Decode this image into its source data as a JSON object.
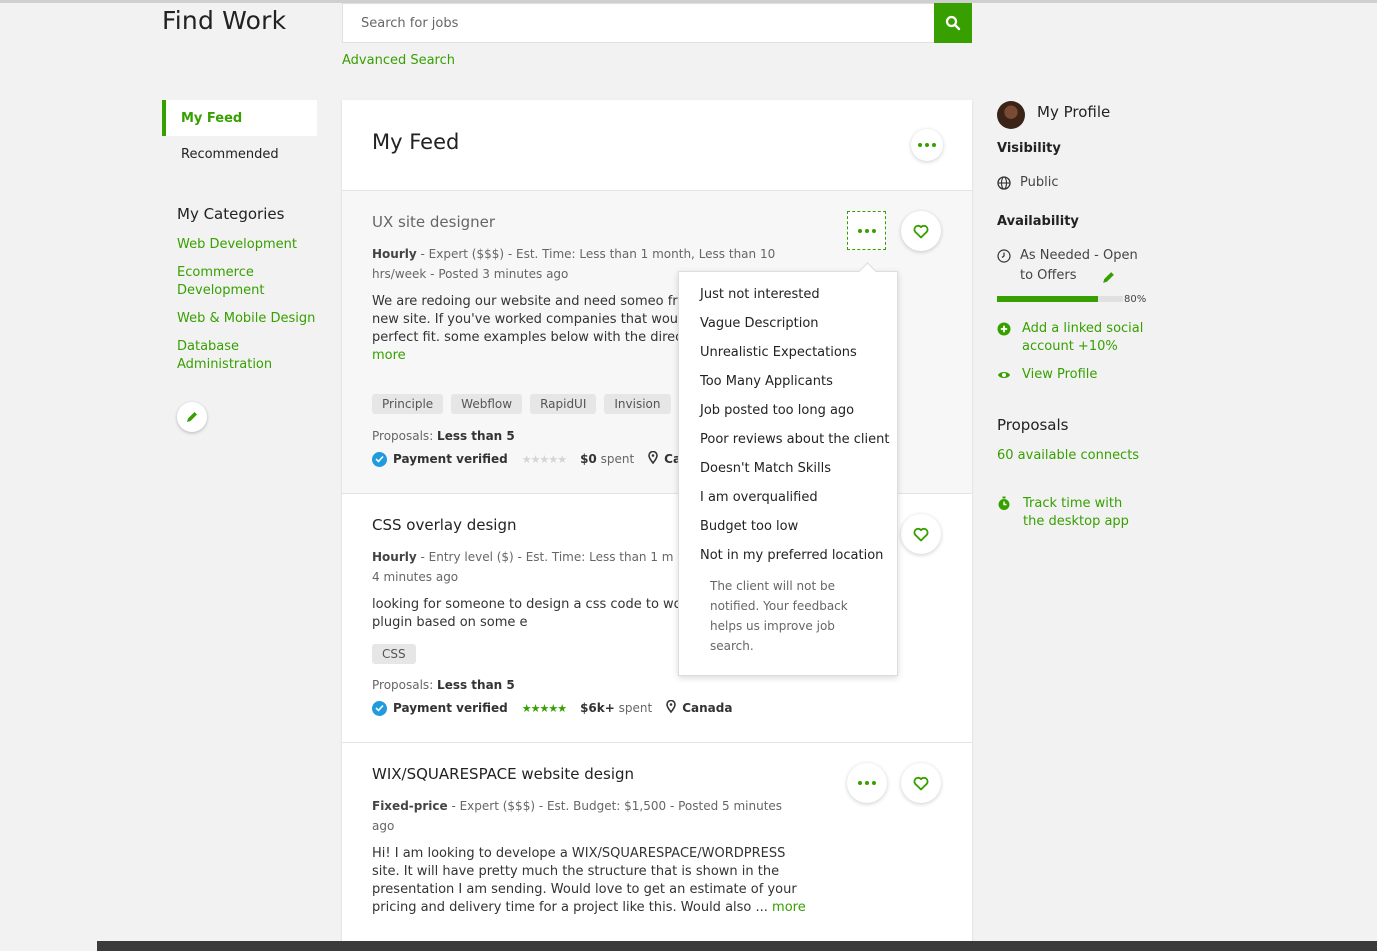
{
  "header": {
    "title": "Find Work",
    "search_placeholder": "Search for jobs",
    "advanced_search": "Advanced Search"
  },
  "feed_nav": {
    "items": [
      {
        "label": "My Feed",
        "active": true
      },
      {
        "label": "Recommended",
        "active": false
      }
    ]
  },
  "categories": {
    "title": "My Categories",
    "items": [
      "Web Development",
      "Ecommerce Development",
      "Web & Mobile Design",
      "Database Administration"
    ]
  },
  "feed": {
    "title": "My Feed",
    "jobs": [
      {
        "title": "UX site designer",
        "type": "Hourly",
        "meta": " - Expert ($$$) - Est. Time: Less than 1 month, Less than 10 hrs/week - Posted 3 minutes ago",
        "description": "We are redoing our website and need someo framework for the new site. If you've worked companies that would would be a perfect fit. some examples below with the direction in w to go wi ... ",
        "more": "more",
        "tags": [
          "Principle",
          "Webflow",
          "RapidUI",
          "Invision"
        ],
        "proposals_label": "Proposals: ",
        "proposals_value": "Less than 5",
        "payment": "Payment verified",
        "spent_value": "$0",
        "spent_label": " spent",
        "location": "Ca"
      },
      {
        "title": "CSS overlay design",
        "type": "Hourly",
        "meta": " - Entry level ($) - Est. Time: Less than 1 m hrs/week - Posted 4 minutes ago",
        "description": "looking for someone to design a css code to wordpress elementor plugin based on some e",
        "tags": [
          "CSS"
        ],
        "proposals_label": "Proposals: ",
        "proposals_value": "Less than 5",
        "payment": "Payment verified",
        "spent_value": "$6k+",
        "spent_label": " spent",
        "location": "Canada"
      },
      {
        "title": "WIX/SQUARESPACE website design",
        "type": "Fixed-price",
        "meta": " - Expert ($$$) - Est. Budget: $1,500 - Posted 5 minutes ago",
        "description": "Hi! I am looking to develope a WIX/SQUARESPACE/WORDPRESS site. It will have pretty much the structure that is shown in the presentation I am sending. Would love to get an estimate of your pricing and delivery time for a project like this. Would also ... ",
        "more": "more"
      }
    ]
  },
  "dropdown": {
    "items": [
      "Just not interested",
      "Vague Description",
      "Unrealistic Expectations",
      "Too Many Applicants",
      "Job posted too long ago",
      "Poor reviews about the client",
      "Doesn't Match Skills",
      "I am overqualified",
      "Budget too low",
      "Not in my preferred location"
    ],
    "note": "The client will not be notified. Your feedback helps us improve job search."
  },
  "profile": {
    "title": "My Profile",
    "visibility_label": "Visibility",
    "visibility_value": "Public",
    "availability_label": "Availability",
    "availability_value": "As Needed - Open to Offers",
    "progress_percent": 80,
    "progress_label": "80%",
    "add_social": "Add a linked social account +10%",
    "view_profile": "View Profile",
    "proposals_title": "Proposals",
    "connects": "60 available connects",
    "track_time": "Track time with the desktop app"
  },
  "colors": {
    "accent": "#37a000",
    "verified": "#1f9bde",
    "background": "#f2f2f2"
  }
}
